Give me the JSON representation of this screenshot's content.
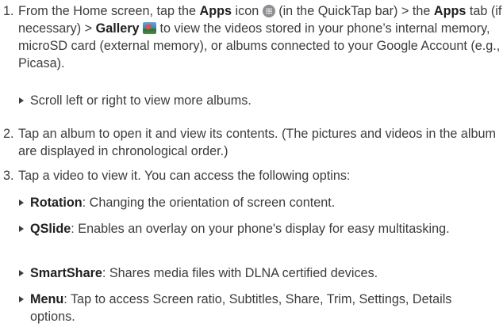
{
  "steps": [
    {
      "num": "1.",
      "t1": "From the Home screen, tap the ",
      "b1": "Apps",
      "t2": " icon ",
      "icon1": "apps-icon",
      "t3": " (in the QuickTap bar) > the ",
      "b2": "Apps",
      "t4": " tab (if necessary) > ",
      "b3": "Gallery",
      "t5": " ",
      "icon2": "gallery-icon",
      "t6": " to view the videos stored in your phone’s internal memory, microSD card (external memory), or albums connected to your Google Account (e.g., Picasa).",
      "bullets": [
        {
          "text": "Scroll left or right to view more albums."
        }
      ]
    },
    {
      "num": "2.",
      "text": "Tap an album to open it and view its contents. (The pictures and videos in the album are displayed in chronological order.)"
    },
    {
      "num": "3.",
      "text": "Tap a video to view it. You can access the following optins:",
      "bullets": [
        {
          "bold": "Rotation",
          "text": ": Changing the orientation of screen content."
        },
        {
          "bold": "QSlide",
          "text": ": Enables an overlay on your phone's display for easy multitasking."
        },
        {
          "bold": "SmartShare",
          "text": ": Shares media files with DLNA certified devices."
        },
        {
          "bold": "Menu",
          "text": ": Tap to access Screen ratio, Subtitles, Share, Trim, Settings, Details options."
        }
      ]
    }
  ]
}
